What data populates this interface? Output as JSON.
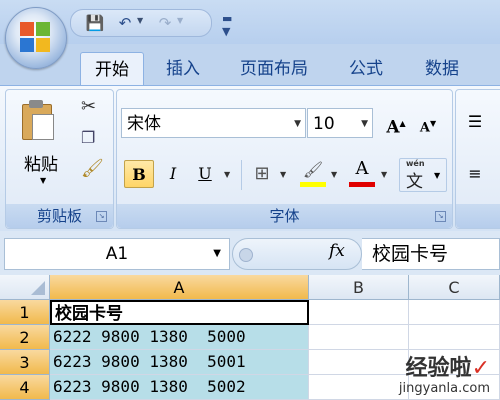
{
  "colors": {
    "accent": "#15428b",
    "selected_cell_fill": "#b7dee8",
    "header_selected": "#f1b94c",
    "font_color_bar": "#e00000",
    "highlight_bar": "#ffff00"
  },
  "quick_access": {
    "save_icon": "save-icon",
    "undo_icon": "undo-icon",
    "redo_icon": "redo-icon",
    "customize_icon": "customize-qat-icon"
  },
  "tabs": [
    {
      "label": "开始"
    },
    {
      "label": "插入"
    },
    {
      "label": "页面布局"
    },
    {
      "label": "公式"
    },
    {
      "label": "数据"
    }
  ],
  "clipboard": {
    "paste_label": "粘贴",
    "group_label": "剪贴板"
  },
  "font": {
    "name": "宋体",
    "size": "10",
    "grow_label": "A",
    "shrink_label": "A",
    "bold": "B",
    "italic": "I",
    "underline": "U",
    "font_color_label": "A",
    "phonetic_label": "wén",
    "phonetic_char": "文",
    "group_label": "字体"
  },
  "formula_bar": {
    "cell_ref": "A1",
    "fx": "fx",
    "value": "校园卡号"
  },
  "sheet": {
    "corner": "",
    "columns": [
      "A",
      "B",
      "C"
    ],
    "rows": [
      {
        "num": "1",
        "a": "校园卡号"
      },
      {
        "num": "2",
        "a": "6222 9800 1380  5000"
      },
      {
        "num": "3",
        "a": "6223 9800 1380  5001"
      },
      {
        "num": "4",
        "a": "6223 9800 1380  5002"
      }
    ]
  },
  "watermark": {
    "title": "经验啦",
    "check": "✓",
    "url": "jingyanla.com"
  }
}
